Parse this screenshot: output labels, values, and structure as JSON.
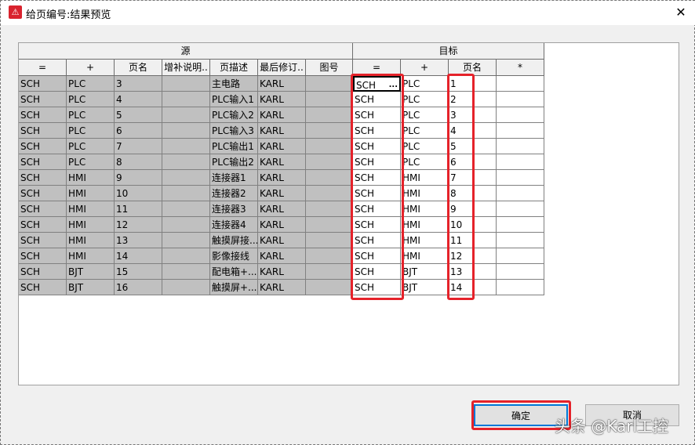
{
  "window": {
    "title": "给页编号:结果预览",
    "close": "✕",
    "icon": "⚠"
  },
  "groups": {
    "source": "源",
    "target": "目标"
  },
  "columns": [
    "=",
    "+",
    "页名",
    "增补说明..",
    "页描述",
    "最后修订..",
    "图号",
    "=",
    "+",
    "页名",
    "*"
  ],
  "rows": [
    [
      "SCH",
      "PLC",
      "3",
      "",
      "主电路",
      "KARL",
      "",
      "SCH",
      "PLC",
      "1",
      ""
    ],
    [
      "SCH",
      "PLC",
      "4",
      "",
      "PLC输入1",
      "KARL",
      "",
      "SCH",
      "PLC",
      "2",
      ""
    ],
    [
      "SCH",
      "PLC",
      "5",
      "",
      "PLC输入2",
      "KARL",
      "",
      "SCH",
      "PLC",
      "3",
      ""
    ],
    [
      "SCH",
      "PLC",
      "6",
      "",
      "PLC输入3",
      "KARL",
      "",
      "SCH",
      "PLC",
      "4",
      ""
    ],
    [
      "SCH",
      "PLC",
      "7",
      "",
      "PLC输出1",
      "KARL",
      "",
      "SCH",
      "PLC",
      "5",
      ""
    ],
    [
      "SCH",
      "PLC",
      "8",
      "",
      "PLC输出2",
      "KARL",
      "",
      "SCH",
      "PLC",
      "6",
      ""
    ],
    [
      "SCH",
      "HMI",
      "9",
      "",
      "连接器1",
      "KARL",
      "",
      "SCH",
      "HMI",
      "7",
      ""
    ],
    [
      "SCH",
      "HMI",
      "10",
      "",
      "连接器2",
      "KARL",
      "",
      "SCH",
      "HMI",
      "8",
      ""
    ],
    [
      "SCH",
      "HMI",
      "11",
      "",
      "连接器3",
      "KARL",
      "",
      "SCH",
      "HMI",
      "9",
      ""
    ],
    [
      "SCH",
      "HMI",
      "12",
      "",
      "连接器4",
      "KARL",
      "",
      "SCH",
      "HMI",
      "10",
      ""
    ],
    [
      "SCH",
      "HMI",
      "13",
      "",
      "触摸屏接...",
      "KARL",
      "",
      "SCH",
      "HMI",
      "11",
      ""
    ],
    [
      "SCH",
      "HMI",
      "14",
      "",
      "影像接线",
      "KARL",
      "",
      "SCH",
      "HMI",
      "12",
      ""
    ],
    [
      "SCH",
      "BJT",
      "15",
      "",
      "配电箱+...",
      "KARL",
      "",
      "SCH",
      "BJT",
      "13",
      ""
    ],
    [
      "SCH",
      "BJT",
      "16",
      "",
      "触摸屏+...",
      "KARL",
      "",
      "SCH",
      "BJT",
      "14",
      ""
    ]
  ],
  "ellipsis": "...",
  "buttons": {
    "ok": "确定",
    "cancel": "取消"
  },
  "watermark": "头条 @Karl工控",
  "colors": {
    "highlight": "#e5222a",
    "source_bg": "#c0c0c0",
    "focus": "#0078d7"
  }
}
